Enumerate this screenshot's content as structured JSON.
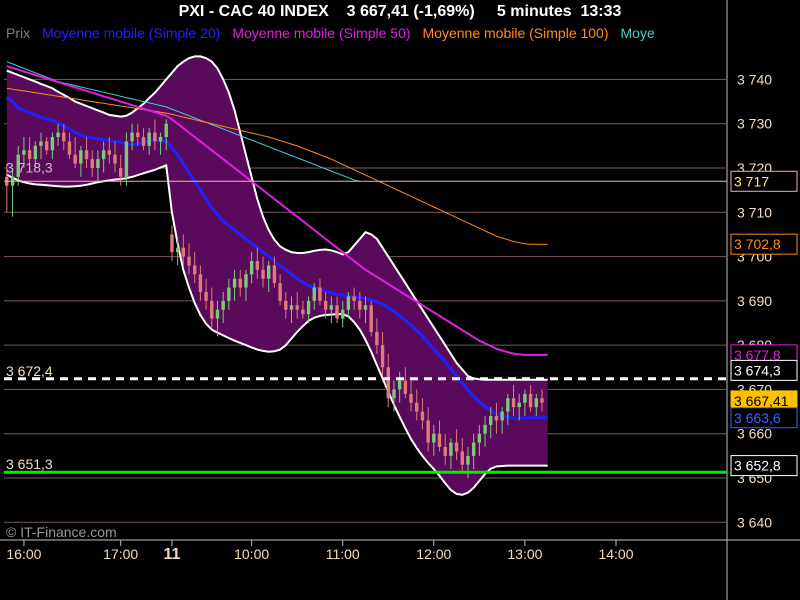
{
  "header": {
    "title": "PXI - CAC 40 INDEX    3 667,41 (-1,69%)     5 minutes  13:33"
  },
  "legend": [
    {
      "label": "Prix",
      "color": "#808080"
    },
    {
      "label": "Moyenne mobile (Simple 20)",
      "color": "#2020ff"
    },
    {
      "label": "Moyenne mobile (Simple 50)",
      "color": "#e020e0"
    },
    {
      "label": "Moyenne mobile (Simple 100)",
      "color": "#ff8c1a"
    },
    {
      "label": "Moye",
      "color": "#40d0d0"
    }
  ],
  "watermark": "© IT-Finance.com",
  "colors": {
    "background": "#000000",
    "band_fill": "#5a0a5a",
    "band_edge": "#ffffff",
    "up_candle": "#7cc97c",
    "down_candle": "#e07a7a",
    "grid": "#7a5a5a",
    "axis_text": "#f0dcc0"
  },
  "chart_data": {
    "type": "candlestick",
    "title": "PXI - CAC 40 INDEX    3 667,41 (-1,69%)     5 minutes  13:33",
    "ylim": [
      3636,
      3748
    ],
    "y_ticks": [
      {
        "v": 3740,
        "label": "3 740"
      },
      {
        "v": 3730,
        "label": "3 730"
      },
      {
        "v": 3720,
        "label": "3 720"
      },
      {
        "v": 3710,
        "label": "3 710"
      },
      {
        "v": 3700,
        "label": "3 700"
      },
      {
        "v": 3690,
        "label": "3 690"
      },
      {
        "v": 3680,
        "label": "3 680"
      },
      {
        "v": 3670,
        "label": "3 670"
      },
      {
        "v": 3660,
        "label": "3 660"
      },
      {
        "v": 3650,
        "label": "3 650"
      },
      {
        "v": 3640,
        "label": "3 640"
      }
    ],
    "x_ticks": [
      {
        "label": "16:00",
        "i": 3,
        "bold": false
      },
      {
        "label": "17:00",
        "i": 20,
        "bold": false
      },
      {
        "label": "11",
        "i": 29,
        "bold": true
      },
      {
        "label": "10:00",
        "i": 43,
        "bold": false
      },
      {
        "label": "11:00",
        "i": 59,
        "bold": false
      },
      {
        "label": "12:00",
        "i": 75,
        "bold": false
      },
      {
        "label": "13:00",
        "i": 91,
        "bold": false
      },
      {
        "label": "14:00",
        "i": 107,
        "bold": false
      }
    ],
    "x_range": [
      -0.5,
      126.5
    ],
    "candles": [
      [
        3718,
        3721,
        3710,
        3716
      ],
      [
        3716,
        3720,
        3709,
        3718
      ],
      [
        3718,
        3725,
        3716,
        3723
      ],
      [
        3723,
        3727,
        3720,
        3724
      ],
      [
        3724,
        3727,
        3721,
        3722
      ],
      [
        3722,
        3726,
        3720,
        3725
      ],
      [
        3725,
        3728,
        3722,
        3726
      ],
      [
        3726,
        3727,
        3723,
        3724
      ],
      [
        3724,
        3728,
        3722,
        3727
      ],
      [
        3727,
        3730,
        3725,
        3728
      ],
      [
        3728,
        3730,
        3724,
        3726
      ],
      [
        3726,
        3728,
        3722,
        3723
      ],
      [
        3723,
        3727,
        3720,
        3721
      ],
      [
        3721,
        3725,
        3718,
        3724
      ],
      [
        3724,
        3727,
        3720,
        3722
      ],
      [
        3722,
        3724,
        3718,
        3720
      ],
      [
        3720,
        3724,
        3717,
        3722
      ],
      [
        3722,
        3726,
        3719,
        3724
      ],
      [
        3724,
        3727,
        3721,
        3723
      ],
      [
        3723,
        3726,
        3719,
        3721
      ],
      [
        3720,
        3723,
        3716,
        3718
      ],
      [
        3718,
        3728,
        3716,
        3726
      ],
      [
        3726,
        3730,
        3724,
        3728
      ],
      [
        3728,
        3730,
        3725,
        3727
      ],
      [
        3727,
        3729,
        3724,
        3725
      ],
      [
        3725,
        3729,
        3723,
        3728
      ],
      [
        3728,
        3731,
        3724,
        3726
      ],
      [
        3726,
        3728,
        3723,
        3727
      ],
      [
        3727,
        3731,
        3724,
        3730
      ],
      [
        3705,
        3707,
        3699,
        3701
      ],
      [
        3701,
        3704,
        3698,
        3702
      ],
      [
        3702,
        3705,
        3698,
        3700
      ],
      [
        3700,
        3703,
        3696,
        3698
      ],
      [
        3698,
        3701,
        3694,
        3696
      ],
      [
        3696,
        3698,
        3690,
        3692
      ],
      [
        3692,
        3695,
        3688,
        3690
      ],
      [
        3690,
        3693,
        3684,
        3686
      ],
      [
        3686,
        3690,
        3682,
        3688
      ],
      [
        3688,
        3692,
        3685,
        3690
      ],
      [
        3690,
        3695,
        3688,
        3693
      ],
      [
        3693,
        3697,
        3690,
        3695
      ],
      [
        3695,
        3697,
        3691,
        3693
      ],
      [
        3693,
        3697,
        3690,
        3696
      ],
      [
        3696,
        3701,
        3694,
        3699
      ],
      [
        3699,
        3702,
        3695,
        3697
      ],
      [
        3697,
        3700,
        3693,
        3695
      ],
      [
        3695,
        3699,
        3692,
        3698
      ],
      [
        3698,
        3700,
        3693,
        3694
      ],
      [
        3694,
        3696,
        3689,
        3690
      ],
      [
        3690,
        3692,
        3686,
        3688
      ],
      [
        3688,
        3691,
        3685,
        3689
      ],
      [
        3689,
        3692,
        3686,
        3688
      ],
      [
        3688,
        3690,
        3686,
        3687
      ],
      [
        3687,
        3691,
        3685,
        3690
      ],
      [
        3690,
        3694,
        3688,
        3693
      ],
      [
        3693,
        3695,
        3689,
        3690
      ],
      [
        3690,
        3692,
        3686,
        3688
      ],
      [
        3688,
        3691,
        3685,
        3689
      ],
      [
        3689,
        3691,
        3685,
        3686
      ],
      [
        3686,
        3690,
        3684,
        3688
      ],
      [
        3688,
        3692,
        3686,
        3691
      ],
      [
        3691,
        3693,
        3688,
        3690
      ],
      [
        3690,
        3692,
        3686,
        3688
      ],
      [
        3688,
        3691,
        3685,
        3689
      ],
      [
        3689,
        3690,
        3682,
        3683
      ],
      [
        3683,
        3686,
        3678,
        3680
      ],
      [
        3680,
        3683,
        3673,
        3675
      ],
      [
        3675,
        3678,
        3666,
        3668
      ],
      [
        3668,
        3672,
        3665,
        3670
      ],
      [
        3670,
        3674,
        3667,
        3672
      ],
      [
        3672,
        3675,
        3668,
        3669
      ],
      [
        3669,
        3672,
        3665,
        3667
      ],
      [
        3667,
        3670,
        3663,
        3665
      ],
      [
        3665,
        3668,
        3661,
        3663
      ],
      [
        3663,
        3666,
        3656,
        3658
      ],
      [
        3658,
        3662,
        3655,
        3660
      ],
      [
        3660,
        3663,
        3656,
        3657
      ],
      [
        3657,
        3660,
        3653,
        3655
      ],
      [
        3655,
        3659,
        3652,
        3658
      ],
      [
        3658,
        3661,
        3654,
        3656
      ],
      [
        3656,
        3659,
        3651,
        3653
      ],
      [
        3653,
        3657,
        3650,
        3655
      ],
      [
        3655,
        3660,
        3652,
        3658
      ],
      [
        3658,
        3662,
        3655,
        3660
      ],
      [
        3660,
        3664,
        3657,
        3662
      ],
      [
        3662,
        3666,
        3659,
        3664
      ],
      [
        3664,
        3667,
        3660,
        3663
      ],
      [
        3663,
        3666,
        3660,
        3665
      ],
      [
        3665,
        3669,
        3662,
        3668
      ],
      [
        3668,
        3671,
        3664,
        3666
      ],
      [
        3666,
        3669,
        3663,
        3667
      ],
      [
        3667,
        3670,
        3664,
        3669
      ],
      [
        3669,
        3671,
        3665,
        3666
      ],
      [
        3666,
        3669,
        3664,
        3668
      ],
      [
        3668,
        3670,
        3665,
        3667
      ]
    ],
    "sma20": [
      3736,
      3735,
      3733.5,
      3733,
      3732.5,
      3732,
      3731.5,
      3731,
      3730.8,
      3730.2,
      3729.5,
      3728.8,
      3728,
      3727.4,
      3727,
      3726.8,
      3726.6,
      3726.4,
      3726.2,
      3726,
      3725.8,
      3725.4,
      3725.2,
      3725.4,
      3725.8,
      3726.2,
      3726.4,
      3726.2,
      3726,
      3724.5,
      3723,
      3721,
      3719,
      3717,
      3715,
      3713,
      3711,
      3709.5,
      3708,
      3707,
      3706,
      3705,
      3704,
      3703,
      3702,
      3701,
      3700,
      3699,
      3698,
      3697,
      3696,
      3695,
      3694.2,
      3693.5,
      3693,
      3692.6,
      3692.2,
      3691.8,
      3691.5,
      3691.3,
      3691.1,
      3690.9,
      3690.7,
      3690.5,
      3690.2,
      3689.8,
      3689.2,
      3688.5,
      3687.6,
      3686.6,
      3685.6,
      3684.5,
      3683.3,
      3682,
      3680.6,
      3679.2,
      3677.7,
      3676.2,
      3674.6,
      3673,
      3671.4,
      3669.9,
      3668.5,
      3667.2,
      3666.1,
      3665.2,
      3664.5,
      3664,
      3663.7,
      3663.5,
      3663.5,
      3663.6,
      3663.6,
      3663.6,
      3663.6,
      3663.6
    ],
    "sma50": [
      3743,
      3742.6,
      3742.2,
      3741.8,
      3741.4,
      3741,
      3740.6,
      3740.2,
      3739.8,
      3739.4,
      3739,
      3738.6,
      3738.2,
      3737.8,
      3737.4,
      3737,
      3736.6,
      3736.2,
      3735.8,
      3735.4,
      3735,
      3734.6,
      3734.2,
      3733.8,
      3733.4,
      3733,
      3732.6,
      3732.2,
      3731.8,
      3731,
      3730,
      3729,
      3728,
      3727,
      3726,
      3725,
      3724,
      3723,
      3722,
      3721,
      3720,
      3719,
      3718,
      3717,
      3716,
      3715,
      3714,
      3713,
      3712,
      3711,
      3710,
      3709,
      3708,
      3707,
      3706,
      3705,
      3704,
      3703,
      3702,
      3701,
      3700,
      3699,
      3698,
      3697,
      3696.2,
      3695.4,
      3694.6,
      3693.8,
      3693,
      3692.2,
      3691.4,
      3690.6,
      3689.8,
      3689,
      3688.2,
      3687.4,
      3686.6,
      3685.8,
      3685,
      3684.2,
      3683.4,
      3682.6,
      3681.8,
      3681,
      3680.4,
      3679.8,
      3679.2,
      3678.8,
      3678.4,
      3678.1,
      3677.9,
      3677.8,
      3677.8,
      3677.8,
      3677.8,
      3677.8
    ],
    "sma100": [
      3738,
      3737.8,
      3737.6,
      3737.4,
      3737.2,
      3737,
      3736.8,
      3736.6,
      3736.4,
      3736.2,
      3736,
      3735.8,
      3735.6,
      3735.4,
      3735.2,
      3735,
      3734.8,
      3734.6,
      3734.4,
      3734.2,
      3734,
      3733.8,
      3733.6,
      3733.4,
      3733.2,
      3733,
      3732.8,
      3732.6,
      3732.4,
      3732.1,
      3731.8,
      3731.5,
      3731.2,
      3730.9,
      3730.6,
      3730.3,
      3730,
      3729.7,
      3729.4,
      3729.1,
      3728.8,
      3728.5,
      3728.2,
      3727.9,
      3727.6,
      3727.3,
      3727,
      3726.6,
      3726.2,
      3725.8,
      3725.4,
      3725,
      3724.5,
      3724,
      3723.5,
      3723,
      3722.5,
      3722,
      3721.4,
      3720.8,
      3720.2,
      3719.6,
      3719,
      3718.4,
      3717.8,
      3717.2,
      3716.6,
      3716,
      3715.4,
      3714.8,
      3714.2,
      3713.6,
      3713,
      3712.4,
      3711.8,
      3711.2,
      3710.6,
      3710,
      3709.4,
      3708.8,
      3708.2,
      3707.6,
      3707,
      3706.4,
      3705.8,
      3705.2,
      3704.6,
      3704.2,
      3703.8,
      3703.4,
      3703.1,
      3702.9,
      3702.8,
      3702.8,
      3702.8,
      3702.8
    ],
    "sma_cyan": [
      3744,
      3743.5,
      3743,
      3742.5,
      3742,
      3741.5,
      3741,
      3740.5,
      3740,
      3739.5,
      3739.2,
      3738.9,
      3738.6,
      3738.3,
      3738,
      3737.7,
      3737.4,
      3737.1,
      3736.8,
      3736.5,
      3736.2,
      3735.9,
      3735.6,
      3735.3,
      3735,
      3734.7,
      3734.4,
      3734.1,
      3733.8,
      3733.3,
      3732.8,
      3732.3,
      3731.8,
      3731.3,
      3730.8,
      3730.3,
      3729.8,
      3729.3,
      3728.8,
      3728.3,
      3727.8,
      3727.3,
      3726.8,
      3726.3,
      3725.8,
      3725.3,
      3724.8,
      3724.3,
      3723.8,
      3723.3,
      3722.8,
      3722.3,
      3721.8,
      3721.3,
      3720.8,
      3720.3,
      3719.8,
      3719.3,
      3718.8,
      3718.3,
      3717.8,
      3717.3,
      3717
    ],
    "band_upper": [
      3742,
      3741.5,
      3741,
      3740.5,
      3740,
      3739.5,
      3739,
      3738.5,
      3738,
      3737.2,
      3736.5,
      3735.8,
      3735,
      3734.5,
      3734,
      3733.5,
      3733,
      3732.5,
      3732,
      3731.8,
      3731.6,
      3731.8,
      3732.5,
      3733.5,
      3734.5,
      3735.8,
      3737,
      3738.5,
      3740,
      3741.5,
      3743,
      3744,
      3744.8,
      3745.2,
      3745.2,
      3744.8,
      3744,
      3742.5,
      3740,
      3737,
      3733,
      3728,
      3723,
      3718,
      3713,
      3709,
      3706,
      3703.8,
      3702.3,
      3701.5,
      3701,
      3700.8,
      3700.8,
      3701,
      3701.3,
      3701.5,
      3701.6,
      3701.4,
      3701,
      3700.5,
      3701,
      3702.5,
      3704,
      3705.5,
      3705,
      3704,
      3702,
      3700,
      3698,
      3696,
      3694,
      3692,
      3690,
      3688,
      3686,
      3684,
      3682,
      3680,
      3678,
      3676,
      3674.5,
      3673,
      3672.5,
      3672.3,
      3672.2,
      3672.2,
      3672.2,
      3672.2,
      3672.2,
      3672.2,
      3672.2,
      3672.2,
      3672.2,
      3672.2,
      3672.2,
      3672.2
    ],
    "band_lower": [
      3718.5,
      3717.8,
      3717.2,
      3716.8,
      3716.5,
      3716.3,
      3716.2,
      3716.1,
      3716,
      3715.9,
      3715.8,
      3715.8,
      3715.9,
      3716,
      3716.2,
      3716.5,
      3716.8,
      3717,
      3717.2,
      3717.4,
      3717.5,
      3717.7,
      3718,
      3718.4,
      3718.8,
      3719.2,
      3719.6,
      3720.1,
      3720.6,
      3710,
      3703,
      3697,
      3693,
      3689.5,
      3686.8,
      3684.8,
      3683.5,
      3682.8,
      3682.2,
      3681.6,
      3681,
      3680.5,
      3680,
      3679.5,
      3679,
      3678.7,
      3678.5,
      3678.6,
      3679,
      3680,
      3681.5,
      3683,
      3684.3,
      3685.5,
      3686.2,
      3686.6,
      3686.8,
      3686.9,
      3687,
      3687,
      3686.5,
      3685.2,
      3683.5,
      3681.2,
      3678.5,
      3675.5,
      3672.5,
      3669.5,
      3666.5,
      3663.8,
      3661.2,
      3658.8,
      3656.8,
      3655,
      3653.4,
      3652,
      3650.5,
      3648.8,
      3647.3,
      3646.4,
      3646.2,
      3646.7,
      3647.8,
      3649.4,
      3650.9,
      3652.1,
      3652.6,
      3652.7,
      3652.8,
      3652.8,
      3652.8,
      3652.8,
      3652.8,
      3652.8,
      3652.8,
      3652.8
    ],
    "hlines": [
      {
        "v": 3717,
        "color": "#f0b0b0",
        "style": "solid",
        "width": 1
      },
      {
        "v": 3672.4,
        "color": "#ffffff",
        "style": "dashed",
        "width": 3
      },
      {
        "v": 3651.3,
        "color": "#00ee00",
        "style": "solid",
        "width": 3
      }
    ],
    "left_labels": [
      {
        "v": 3718.3,
        "text": "3 718,3",
        "color": "#c0c0c0"
      },
      {
        "v": 3672.4,
        "text": "3 672,4",
        "color": "#f0dcc0"
      },
      {
        "v": 3651.3,
        "text": "3 651,3",
        "color": "#f0dcc0"
      }
    ],
    "right_labels": [
      {
        "v": 3717,
        "text": "3 717",
        "bg": "#000000",
        "fg": "#ffe28a",
        "border": "#f0b0b0"
      },
      {
        "v": 3702.8,
        "text": "3 702,8",
        "bg": "#000000",
        "fg": "#ff8c1a",
        "border": "#ff8c1a"
      },
      {
        "v": 3677.8,
        "text": "3 677,8",
        "bg": "#000000",
        "fg": "#e020e0",
        "border": "#e020e0"
      },
      {
        "v": 3674.3,
        "text": "3 674,3",
        "bg": "#000000",
        "fg": "#ffffff",
        "border": "#ffffff"
      },
      {
        "v": 3667.41,
        "text": "3 667,41",
        "bg": "#ffc000",
        "fg": "#000000",
        "border": "#ffc000"
      },
      {
        "v": 3663.6,
        "text": "3 663,6",
        "bg": "#000000",
        "fg": "#4060ff",
        "border": "#4060ff"
      },
      {
        "v": 3652.8,
        "text": "3 652,8",
        "bg": "#000000",
        "fg": "#ffffff",
        "border": "#ffffff"
      }
    ]
  }
}
